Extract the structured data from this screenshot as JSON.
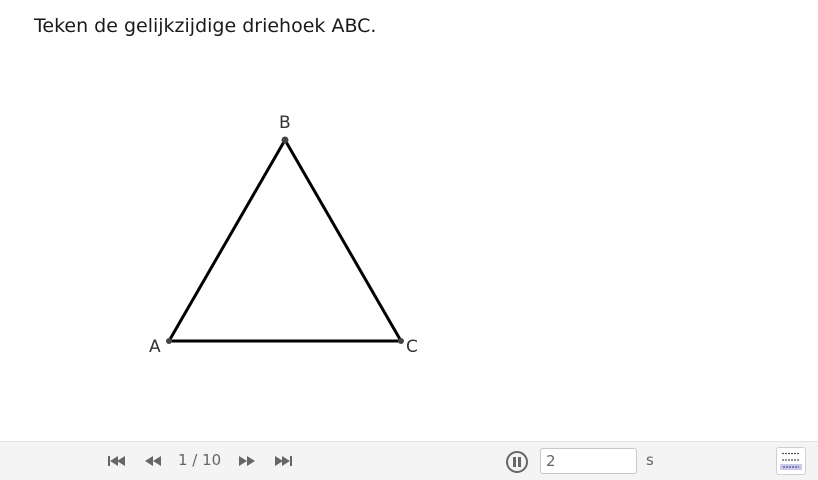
{
  "instruction": "Teken de gelijkzijdige driehoek ABC.",
  "points": [
    {
      "name": "A",
      "label": "A"
    },
    {
      "name": "B",
      "label": "B"
    },
    {
      "name": "C",
      "label": "C"
    }
  ],
  "navigation": {
    "step_counter": "1 / 10",
    "first_icon": "skip-to-start-icon",
    "previous_icon": "rewind-icon",
    "next_icon": "fast-forward-icon",
    "last_icon": "skip-to-end-icon",
    "pause_icon": "pause-icon",
    "speed_value": "2",
    "speed_unit": "s",
    "algebra_icon": "algebra-view-icon"
  },
  "colors": {
    "triangle_stroke": "#000000",
    "point_fill": "#444444",
    "nav_icon": "#666666",
    "nav_background": "#f4f4f4"
  }
}
